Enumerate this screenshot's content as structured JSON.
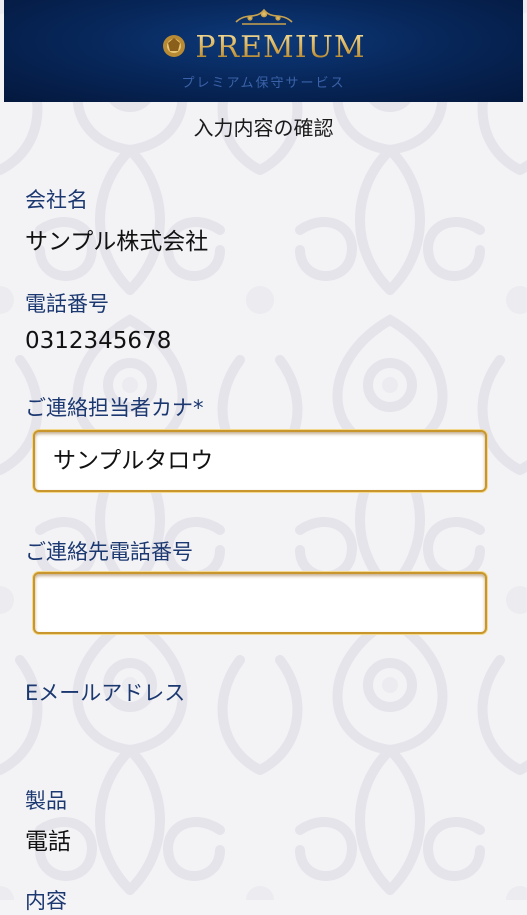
{
  "header": {
    "brand": "PREMIUM",
    "subtitle": "プレミアム保守サービス"
  },
  "page": {
    "title": "入力内容の確認"
  },
  "fields": {
    "company": {
      "label": "会社名",
      "value": "サンプル株式会社"
    },
    "phone": {
      "label": "電話番号",
      "value": "0312345678"
    },
    "contact_kana": {
      "label": "ご連絡担当者カナ*",
      "value": "サンプルタロウ"
    },
    "contact_phone": {
      "label": "ご連絡先電話番号",
      "value": ""
    },
    "email": {
      "label": "Eメールアドレス",
      "value": ""
    },
    "product": {
      "label": "製品",
      "value": "電話"
    },
    "details": {
      "label": "内容"
    }
  },
  "colors": {
    "header_bg": "#072659",
    "brand_gold": "#d9b35c",
    "label_blue": "#1c3870",
    "field_border": "#c9962e"
  }
}
